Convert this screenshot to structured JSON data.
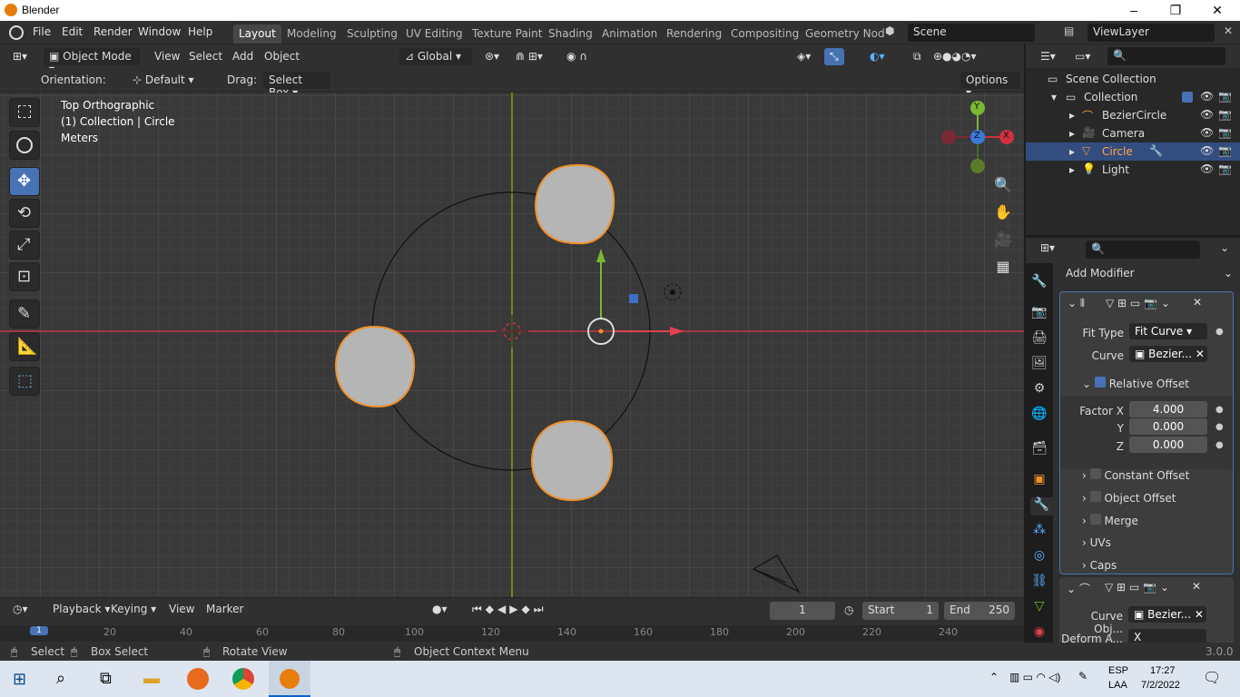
{
  "window": {
    "title": "Blender",
    "minimize": "–",
    "maximize": "❐",
    "close": "✕"
  },
  "topbar": {
    "menus": [
      "File",
      "Edit",
      "Render",
      "Window",
      "Help"
    ],
    "workspaces": [
      "Layout",
      "Modeling",
      "Sculpting",
      "UV Editing",
      "Texture Paint",
      "Shading",
      "Animation",
      "Rendering",
      "Compositing",
      "Geometry Nod"
    ],
    "scene": "Scene",
    "view_layer": "ViewLayer"
  },
  "viewport_header": {
    "mode": "Object Mode",
    "menus": [
      "View",
      "Select",
      "Add",
      "Object"
    ],
    "transform_orientation": "Global"
  },
  "tool_settings": {
    "orientation_label": "Orientation:",
    "orientation_value": "Default",
    "drag_label": "Drag:",
    "drag_value": "Select Box",
    "options": "Options"
  },
  "viewport_overlay": {
    "view_name": "Top Orthographic",
    "collection_info": "(1) Collection | Circle",
    "units": "Meters"
  },
  "gizmo": {
    "y": "Y",
    "z": "Z",
    "x": "X"
  },
  "outliner": {
    "root": "Scene Collection",
    "collection": "Collection",
    "items": [
      {
        "name": "BezierCircle",
        "selected": false
      },
      {
        "name": "Camera",
        "selected": false
      },
      {
        "name": "Circle",
        "selected": true
      },
      {
        "name": "Light",
        "selected": false
      }
    ]
  },
  "properties": {
    "add_modifier": "Add Modifier",
    "array": {
      "fit_type_label": "Fit Type",
      "fit_type": "Fit Curve",
      "curve_label": "Curve",
      "curve": "Bezier...",
      "relative_offset": "Relative Offset",
      "factor_x_label": "Factor X",
      "factor_x": "4.000",
      "y_label": "Y",
      "y": "0.000",
      "z_label": "Z",
      "z": "0.000",
      "constant_offset": "Constant Offset",
      "object_offset": "Object Offset",
      "merge": "Merge",
      "uvs": "UVs",
      "caps": "Caps"
    },
    "curve_mod": {
      "curve_obj_label": "Curve Obj...",
      "curve_obj": "Bezier...",
      "deform_label": "Deform A...",
      "deform": "X"
    }
  },
  "timeline": {
    "menus": [
      "Playback",
      "Keying",
      "View",
      "Marker"
    ],
    "current_frame": "1",
    "start_label": "Start",
    "start": "1",
    "end_label": "End",
    "end": "250",
    "ruler": [
      "1",
      "20",
      "40",
      "60",
      "80",
      "100",
      "120",
      "140",
      "160",
      "180",
      "200",
      "220",
      "240"
    ]
  },
  "statusbar": {
    "select": "Select",
    "box_select": "Box Select",
    "rotate_view": "Rotate View",
    "context_menu": "Object Context Menu",
    "version": "3.0.0"
  },
  "taskbar": {
    "lang1": "ESP",
    "lang2": "LAA",
    "time": "17:27",
    "date": "7/2/2022"
  }
}
